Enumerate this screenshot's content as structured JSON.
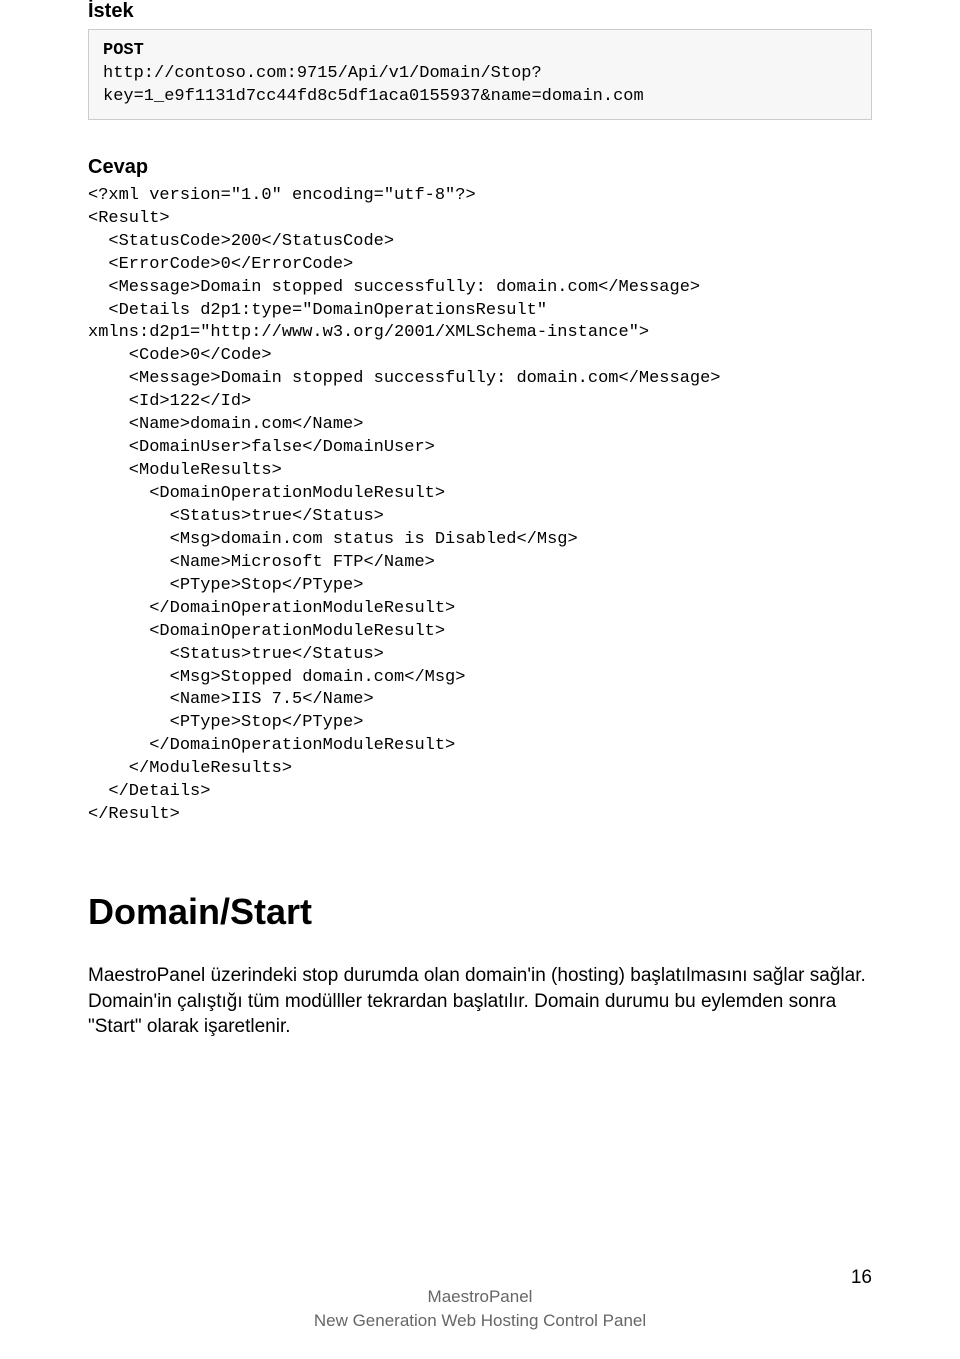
{
  "request": {
    "title": "İstek",
    "method": "POST",
    "url": "http://contoso.com:9715/Api/v1/Domain/Stop?key=1_e9f1131d7cc44fd8c5df1aca0155937&name=domain.com"
  },
  "response": {
    "title": "Cevap",
    "xml": "<?xml version=\"1.0\" encoding=\"utf-8\"?>\n<Result>\n  <StatusCode>200</StatusCode>\n  <ErrorCode>0</ErrorCode>\n  <Message>Domain stopped successfully: domain.com</Message>\n  <Details d2p1:type=\"DomainOperationsResult\"\nxmlns:d2p1=\"http://www.w3.org/2001/XMLSchema-instance\">\n    <Code>0</Code>\n    <Message>Domain stopped successfully: domain.com</Message>\n    <Id>122</Id>\n    <Name>domain.com</Name>\n    <DomainUser>false</DomainUser>\n    <ModuleResults>\n      <DomainOperationModuleResult>\n        <Status>true</Status>\n        <Msg>domain.com status is Disabled</Msg>\n        <Name>Microsoft FTP</Name>\n        <PType>Stop</PType>\n      </DomainOperationModuleResult>\n      <DomainOperationModuleResult>\n        <Status>true</Status>\n        <Msg>Stopped domain.com</Msg>\n        <Name>IIS 7.5</Name>\n        <PType>Stop</PType>\n      </DomainOperationModuleResult>\n    </ModuleResults>\n  </Details>\n</Result>"
  },
  "endpoint": {
    "heading": "Domain/Start",
    "description": "MaestroPanel üzerindeki stop durumda olan domain'in (hosting) başlatılmasını sağlar sağlar. Domain'in çalıştığı tüm modülller tekrardan başlatılır. Domain durumu bu eylemden sonra \"Start\" olarak işaretlenir."
  },
  "footer": {
    "line1": "MaestroPanel",
    "line2": "New Generation Web Hosting Control Panel"
  },
  "page_number": "16"
}
